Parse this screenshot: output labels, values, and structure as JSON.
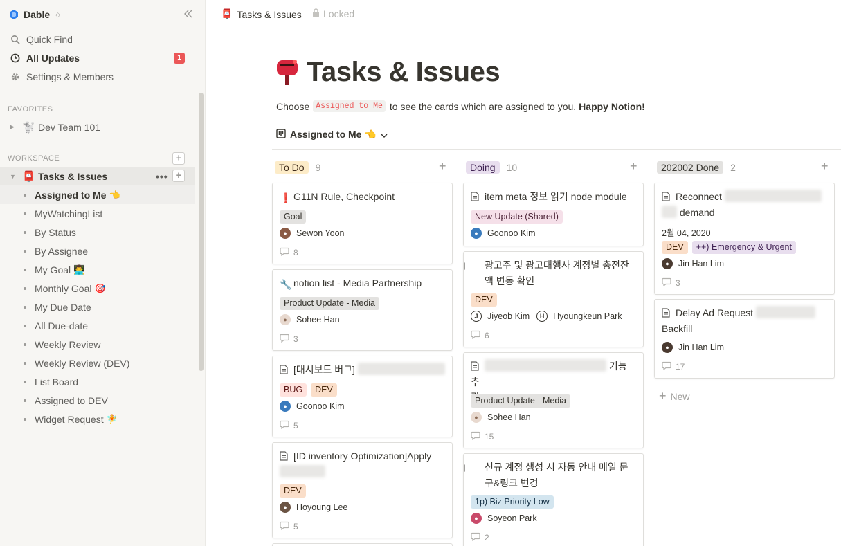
{
  "workspace": {
    "name": "Dable"
  },
  "sidebar": {
    "quick_find": "Quick Find",
    "all_updates": "All Updates",
    "all_updates_badge": "1",
    "settings": "Settings & Members",
    "favorites_label": "FAVORITES",
    "favorites": [
      {
        "emoji": "🐩",
        "label": "Dev Team 101"
      }
    ],
    "workspace_label": "WORKSPACE",
    "page": {
      "emoji": "📮",
      "label": "Tasks & Issues"
    },
    "subpages": [
      {
        "label": "Assigned to Me",
        "tail": "👈"
      },
      {
        "label": "MyWatchingList",
        "tail": ""
      },
      {
        "label": "By Status",
        "tail": ""
      },
      {
        "label": "By Assignee",
        "tail": ""
      },
      {
        "label": "My Goal",
        "tail": "👨‍💻"
      },
      {
        "label": "Monthly Goal",
        "tail": "🎯"
      },
      {
        "label": "My Due Date",
        "tail": ""
      },
      {
        "label": "All Due-date",
        "tail": ""
      },
      {
        "label": "Weekly Review",
        "tail": ""
      },
      {
        "label": "Weekly Review (DEV)",
        "tail": ""
      },
      {
        "label": "List Board",
        "tail": ""
      },
      {
        "label": "Assigned to DEV",
        "tail": ""
      },
      {
        "label": "Widget Request",
        "tail": "🧚"
      }
    ]
  },
  "topbar": {
    "breadcrumb": "Tasks & Issues",
    "locked": "Locked"
  },
  "page": {
    "emoji": "📮",
    "title": "Tasks & Issues",
    "desc_before": "Choose",
    "desc_code": "Assigned to Me",
    "desc_after": "to see the cards which are assigned to you.",
    "desc_bold": "Happy Notion!",
    "view_name": "Assigned to Me 👈"
  },
  "colors": {
    "accent_red": "#eb5757",
    "tag_gray": "#e3e2e0"
  },
  "board": {
    "columns": [
      {
        "name": "To Do",
        "count": "9",
        "color": "yellow"
      },
      {
        "name": "Doing",
        "count": "10",
        "color": "purple"
      },
      {
        "name": "202002 Done",
        "count": "2",
        "color": "gray"
      }
    ],
    "new_label": "New",
    "cards": {
      "todo": [
        {
          "icon": "❗",
          "title": "G11N Rule, Checkpoint",
          "tags": [
            "Goal"
          ],
          "person": "Sewon Yoon",
          "comments": "8"
        },
        {
          "icon": "🔧",
          "title": "notion list - Media Partnership",
          "tags": [
            "Product Update - Media"
          ],
          "person": "Sohee Han",
          "comments": "3"
        },
        {
          "icon": "page-icon",
          "title": "[대시보드 버그]",
          "tags": [
            "BUG",
            "DEV"
          ],
          "person": "Goonoo Kim",
          "comments": "5"
        },
        {
          "icon": "page-icon",
          "title": "[ID inventory Optimization]Apply",
          "tags": [
            "DEV"
          ],
          "person": "Hoyoung Lee",
          "comments": "5"
        }
      ],
      "doing": [
        {
          "icon": "page-icon",
          "title": "item meta 정보 읽기 node module",
          "tags": [
            "New Update (Shared)"
          ],
          "person": "Goonoo Kim",
          "comments": ""
        },
        {
          "icon": "page-icon",
          "title": "광고주 및 광고대행사 계정별 충전잔액 변동 확인",
          "tags": [
            "DEV"
          ],
          "person": "Jiyeob Kim",
          "person2": "Hyoungkeun Park",
          "comments": "6"
        },
        {
          "icon": "page-icon",
          "title_a": "기능 추",
          "title_b": "가",
          "tags": [
            "Product Update - Media"
          ],
          "person": "Sohee Han",
          "comments": "15"
        },
        {
          "icon": "page-icon",
          "title": "신규 계정 생성 시 자동 안내 메일 문구&링크 변경",
          "tags": [
            "1p) Biz Priority Low"
          ],
          "person": "Soyeon Park",
          "comments": "2"
        }
      ],
      "done": [
        {
          "icon": "page-icon",
          "title_a": "Reconnect",
          "title_b": "demand",
          "date": "2월 04, 2020",
          "tags": [
            "DEV",
            "++) Emergency & Urgent"
          ],
          "person": "Jin Han Lim",
          "comments": "3"
        },
        {
          "icon": "page-icon",
          "title_a": "Delay Ad Request",
          "title_b": "Backfill",
          "tags": [],
          "person": "Jin Han Lim",
          "comments": "17"
        }
      ]
    }
  }
}
